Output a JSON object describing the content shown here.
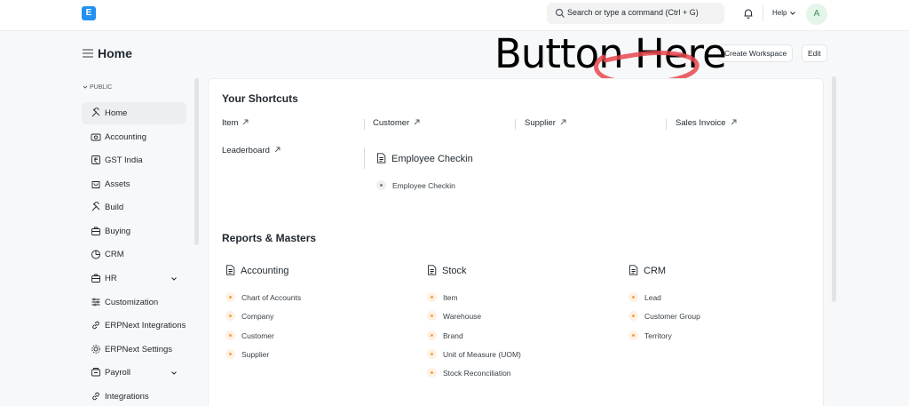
{
  "navbar": {
    "logo_letter": "E",
    "search_placeholder": "Search or type a command (Ctrl + G)",
    "help_label": "Help",
    "avatar_letter": "A"
  },
  "header": {
    "title": "Home",
    "create_workspace_label": "Create Workspace",
    "edit_label": "Edit"
  },
  "annotation": {
    "text": "Button Here",
    "color": "#e8474e"
  },
  "sidebar": {
    "section_label": "PUBLIC",
    "items": [
      {
        "label": "Home",
        "icon": "tools-icon",
        "active": true
      },
      {
        "label": "Accounting",
        "icon": "money-icon"
      },
      {
        "label": "GST India",
        "icon": "rupee-icon"
      },
      {
        "label": "Assets",
        "icon": "bag-icon"
      },
      {
        "label": "Build",
        "icon": "tools-icon"
      },
      {
        "label": "Buying",
        "icon": "briefcase-icon"
      },
      {
        "label": "CRM",
        "icon": "pie-icon"
      },
      {
        "label": "HR",
        "icon": "briefcase-icon",
        "expandable": true
      },
      {
        "label": "Customization",
        "icon": "sliders-icon"
      },
      {
        "label": "ERPNext Integrations",
        "icon": "link-icon"
      },
      {
        "label": "ERPNext Settings",
        "icon": "gear-icon"
      },
      {
        "label": "Payroll",
        "icon": "receipt-icon",
        "expandable": true
      },
      {
        "label": "Integrations",
        "icon": "link-icon"
      }
    ]
  },
  "shortcuts": {
    "title": "Your Shortcuts",
    "items": [
      "Item",
      "Customer",
      "Supplier",
      "Sales Invoice",
      "Leaderboard"
    ]
  },
  "employee_card": {
    "title": "Employee Checkin",
    "links": [
      "Employee Checkin"
    ]
  },
  "reports": {
    "title": "Reports & Masters",
    "cards": [
      {
        "title": "Accounting",
        "links": [
          "Chart of Accounts",
          "Company",
          "Customer",
          "Supplier"
        ]
      },
      {
        "title": "Stock",
        "links": [
          "Item",
          "Warehouse",
          "Brand",
          "Unit of Measure (UOM)",
          "Stock Reconciliation"
        ]
      },
      {
        "title": "CRM",
        "links": [
          "Lead",
          "Customer Group",
          "Territory"
        ]
      }
    ]
  },
  "colors": {
    "brand": "#2490ef",
    "bullet_orange": "#f3a24a",
    "annotation": "#e8474e"
  }
}
